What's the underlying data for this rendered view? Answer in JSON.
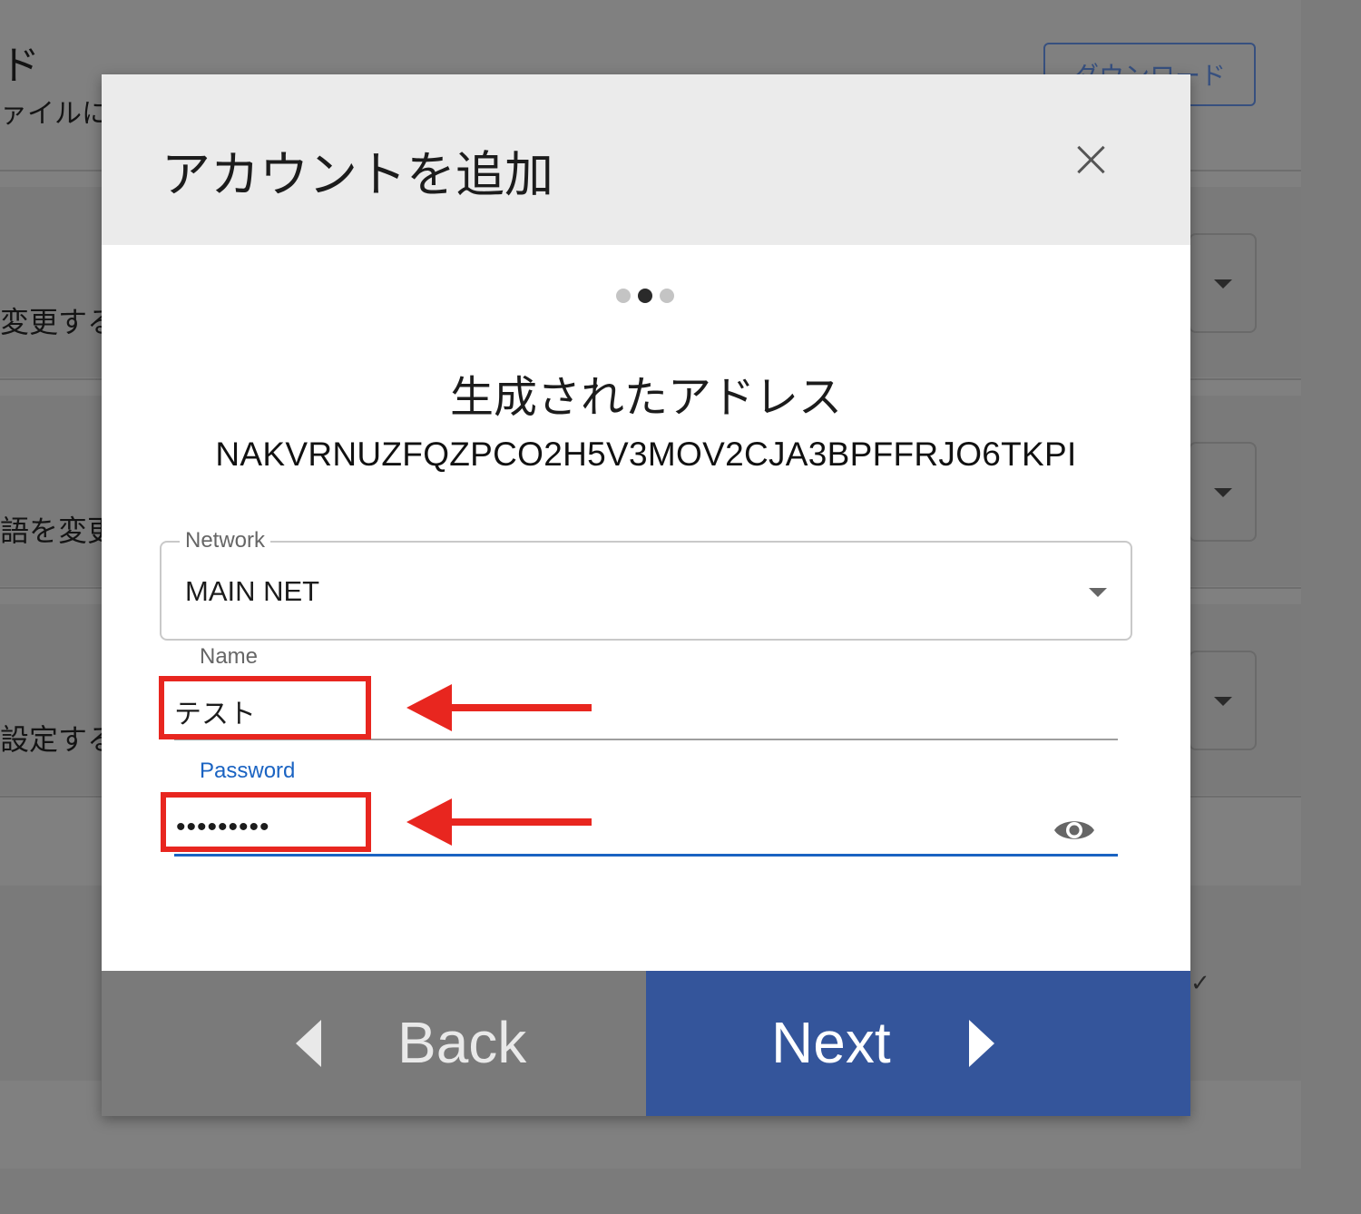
{
  "background": {
    "title": "ド",
    "description": "ァイルに",
    "download_button": "ダウンロード",
    "rows": [
      {
        "label": "変更する"
      },
      {
        "label": "語を変更"
      },
      {
        "label": "設定する"
      }
    ]
  },
  "modal": {
    "title": "アカウントを追加",
    "close_icon": "close-icon",
    "steps": {
      "total": 3,
      "current": 2
    },
    "address_heading": "生成されたアドレス",
    "address": "NAKVRNUZFQZPCO2H5V3MOV2CJA3BPFFRJO6TKPI",
    "network": {
      "label": "Network",
      "value": "MAIN NET"
    },
    "name": {
      "label": "Name",
      "value": "テスト"
    },
    "password": {
      "label": "Password",
      "value": "•••••••••"
    },
    "back_label": "Back",
    "next_label": "Next"
  },
  "colors": {
    "overlay": "#808080",
    "accent_blue": "#34559b",
    "focus_blue": "#1a63c2",
    "annotation_red": "#e8261f"
  }
}
